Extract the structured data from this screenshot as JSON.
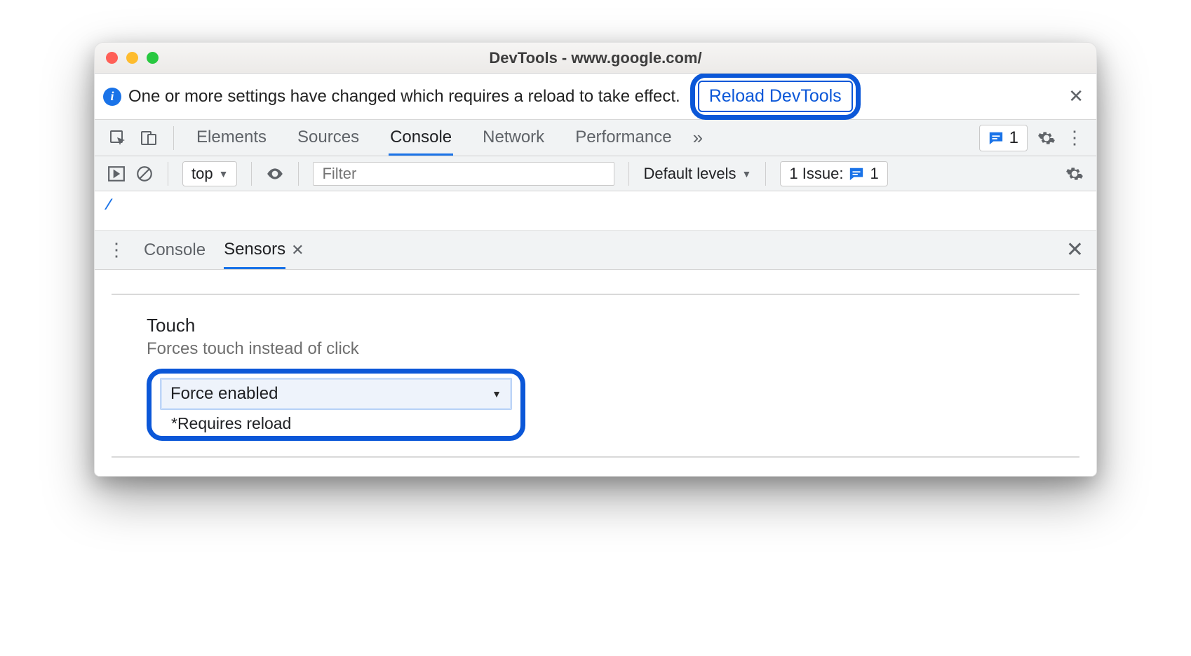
{
  "window": {
    "title": "DevTools - www.google.com/"
  },
  "notification": {
    "message": "One or more settings have changed which requires a reload to take effect.",
    "button": "Reload DevTools"
  },
  "tabs": {
    "items": [
      "Elements",
      "Sources",
      "Console",
      "Network",
      "Performance"
    ],
    "active_index": 2,
    "issues_count": "1"
  },
  "console_toolbar": {
    "context": "top",
    "filter_placeholder": "Filter",
    "levels": "Default levels",
    "issues_label": "1 Issue:",
    "issues_count": "1"
  },
  "drawer": {
    "tabs": [
      "Console",
      "Sensors"
    ],
    "active_index": 1
  },
  "sensors": {
    "section_title": "Touch",
    "section_desc": "Forces touch instead of click",
    "select_value": "Force enabled",
    "footnote": "*Requires reload"
  }
}
